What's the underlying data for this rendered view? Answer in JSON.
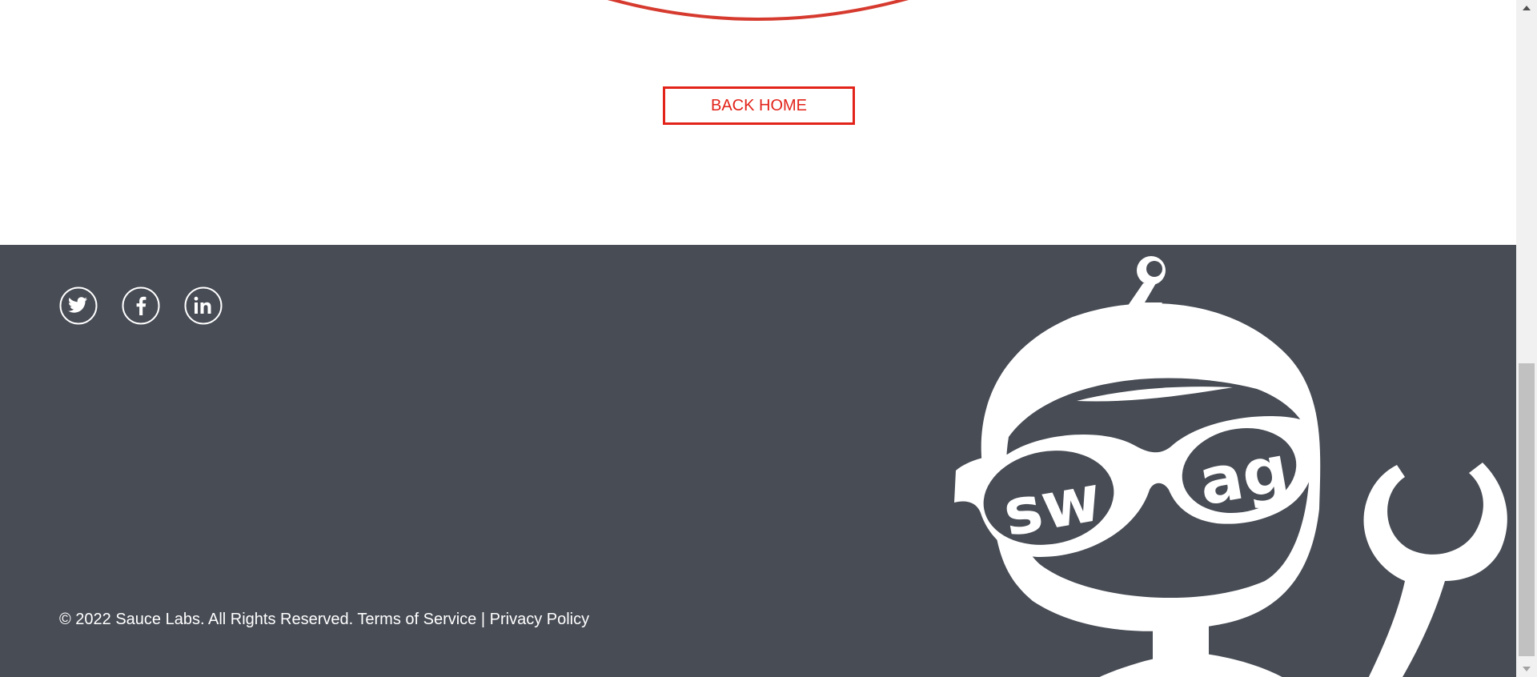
{
  "main": {
    "back_home_label": "BACK HOME"
  },
  "footer": {
    "social": [
      {
        "name": "twitter",
        "icon": "twitter-icon"
      },
      {
        "name": "facebook",
        "icon": "facebook-icon"
      },
      {
        "name": "linkedin",
        "icon": "linkedin-icon"
      }
    ],
    "copyright": "© 2022 Sauce Labs. All Rights Reserved.",
    "terms_label": "Terms of Service",
    "separator": "|",
    "privacy_label": "Privacy Policy",
    "robot_logo_text": "swag"
  },
  "colors": {
    "accent": "#e2231a",
    "footer_bg": "#484c55",
    "footer_text": "#ffffff",
    "arc": "#d63a2e"
  }
}
